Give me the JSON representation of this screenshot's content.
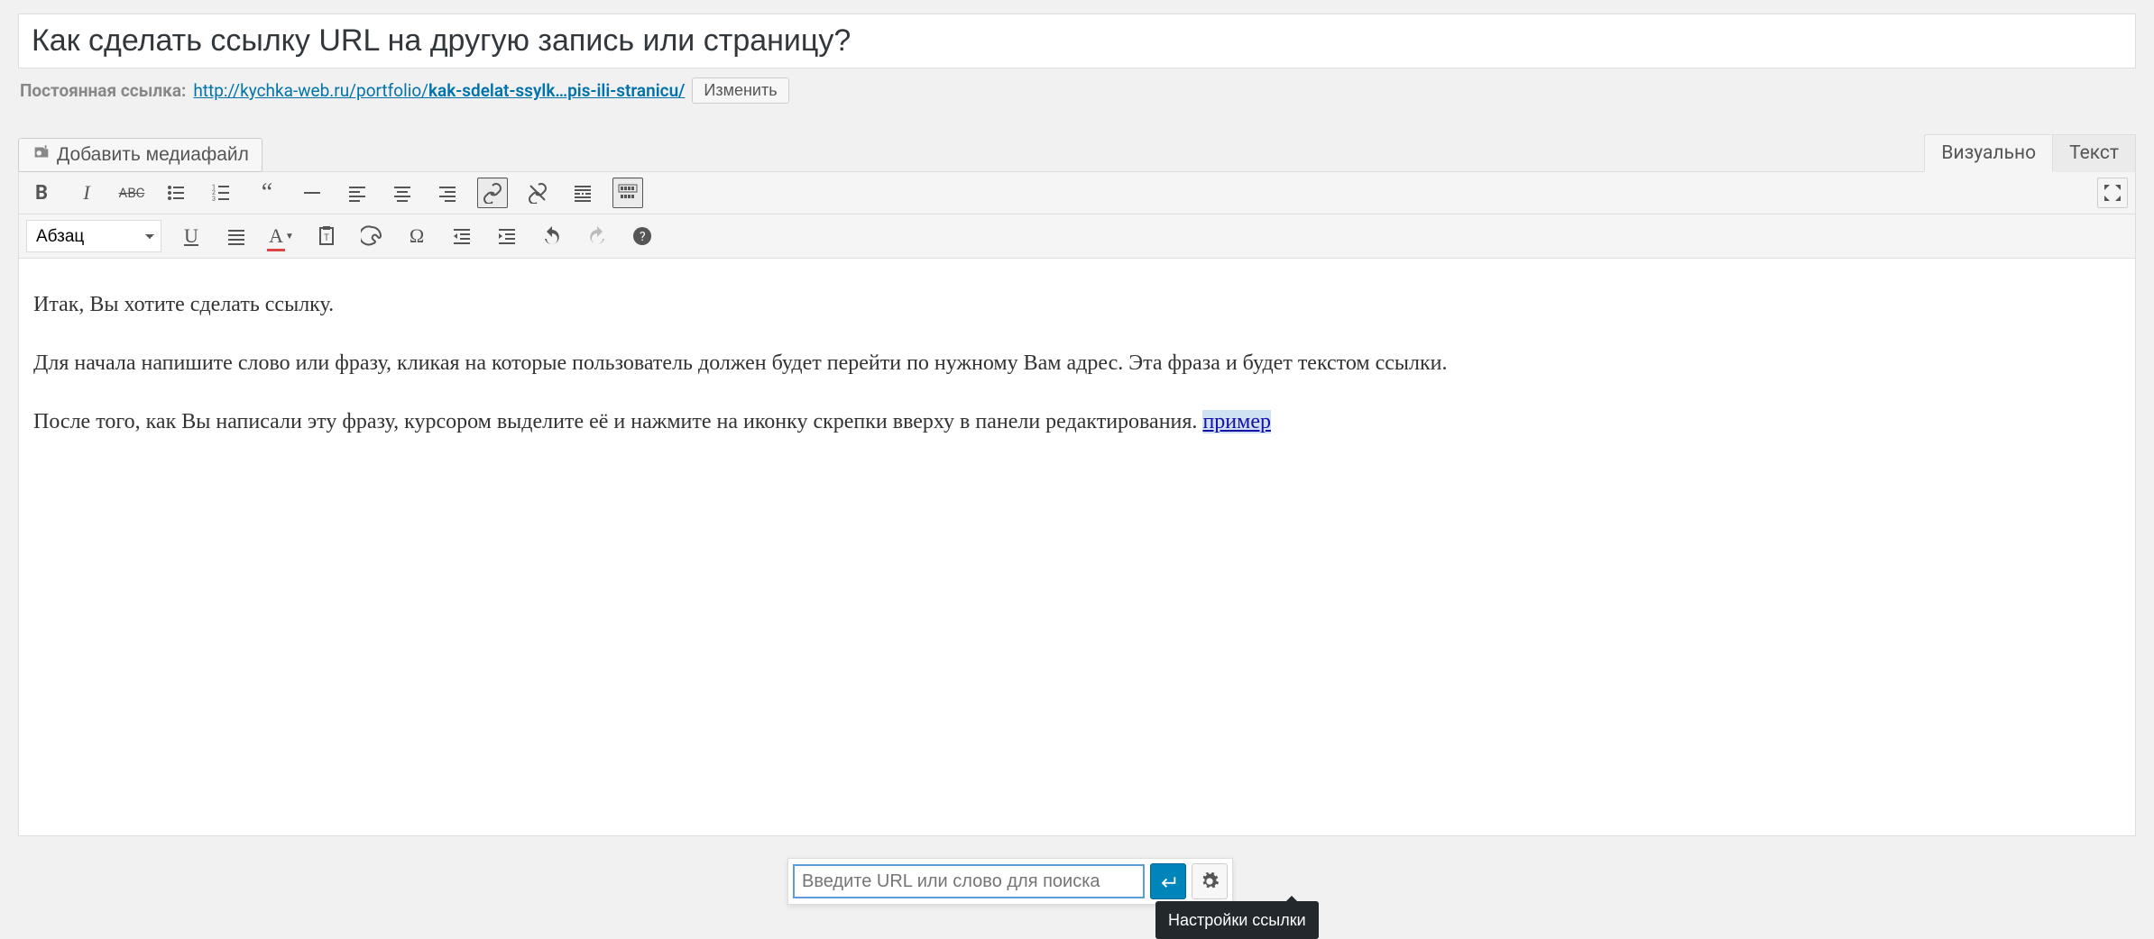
{
  "title": "Как сделать ссылку URL на другую запись или страницу?",
  "permalink": {
    "label": "Постоянная ссылка:",
    "base": "http://kychka-web.ru/portfolio/",
    "slug": "kak-sdelat-ssylk…pis-ili-stranicu/",
    "edit_label": "Изменить"
  },
  "media_button": "Добавить медиафайл",
  "tabs": {
    "visual": "Визуально",
    "text": "Текст"
  },
  "format_select": "Абзац",
  "content": {
    "p1": "Итак, Вы хотите сделать ссылку.",
    "p2": "Для начала напишите слово или фразу, кликая на которые пользователь должен будет перейти по нужному Вам адрес. Эта фраза и будет текстом ссылки.",
    "p3_part1": "После того, как Вы написали эту фразу, курсором выделите её и нажмите на иконку скрепки вверху в панели редактирования. ",
    "p3_link": "пример"
  },
  "link_popover": {
    "placeholder": "Введите URL или слово для поиска",
    "tooltip": "Настройки ссылки"
  },
  "toolbar_icons_row1": [
    "bold",
    "italic",
    "strikethrough",
    "bullet-list",
    "numbered-list",
    "blockquote",
    "hr",
    "align-left",
    "align-center",
    "align-right",
    "link",
    "unlink",
    "more",
    "kitchen-sink"
  ],
  "toolbar_icons_row2": [
    "underline",
    "align-justify",
    "text-color",
    "paste-text",
    "clear-formatting",
    "special-char",
    "outdent",
    "indent",
    "undo",
    "redo",
    "help"
  ]
}
